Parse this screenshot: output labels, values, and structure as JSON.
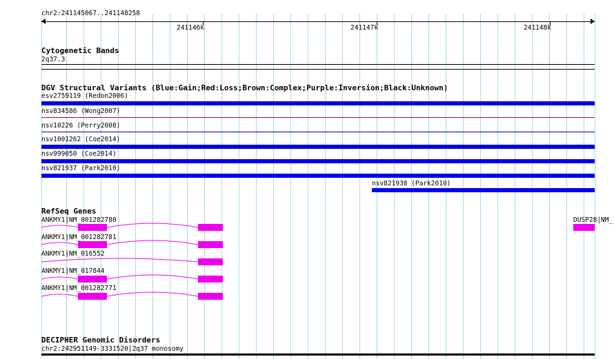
{
  "ruler": {
    "coordinates": "chr2:241145067..241148258",
    "ticks": [
      {
        "label": "241146k",
        "pos": 241146000
      },
      {
        "label": "241147k",
        "pos": 241147000
      },
      {
        "label": "241148k",
        "pos": 241148000
      }
    ]
  },
  "tracks": {
    "cytoband": {
      "title": "Cytogenetic Bands",
      "band": "2q37.3"
    },
    "dgv": {
      "title": "DGV Structural Variants (Blue:Gain;Red:Loss;Brown:Complex;Purple:Inversion;Black:Unknown)",
      "variants": [
        {
          "label": "esv2759119 (Redon2006)",
          "color": "#0000ee",
          "style": "thick"
        },
        {
          "label": "nsv834586 (Wong2007)",
          "color": "#dd0000",
          "style": "thin"
        },
        {
          "label": "nsv10226 (Perry2008)",
          "color": "#0000aa",
          "style": "thin"
        },
        {
          "label": "nsv1001262 (Coe2014)",
          "color": "#0000ee",
          "style": "thick"
        },
        {
          "label": "nsv999050 (Coe2014)",
          "color": "#0000ee",
          "style": "thick"
        },
        {
          "label": "nsv821937 (Park2010)",
          "color": "#0000ee",
          "style": "thick"
        },
        {
          "label": "nsv821938 (Park2010)",
          "color": "#0000ee",
          "style": "thick"
        }
      ]
    },
    "refseq": {
      "title": "RefSeq Genes",
      "color": "#ee00ee",
      "genes": [
        {
          "label": "ANKMY1|NM_001282780"
        },
        {
          "label": "ANKMY1|NM_001282781"
        },
        {
          "label": "ANKMY1|NM_016552"
        },
        {
          "label": "ANKMY1|NM_017844"
        },
        {
          "label": "ANKMY1|NM_001282771"
        },
        {
          "label": "DUSP28|NM_"
        }
      ]
    },
    "decipher": {
      "title": "DECIPHER Genomic Disorders",
      "item": "chr2:242951149-3331520|2q37 monosomy"
    }
  }
}
